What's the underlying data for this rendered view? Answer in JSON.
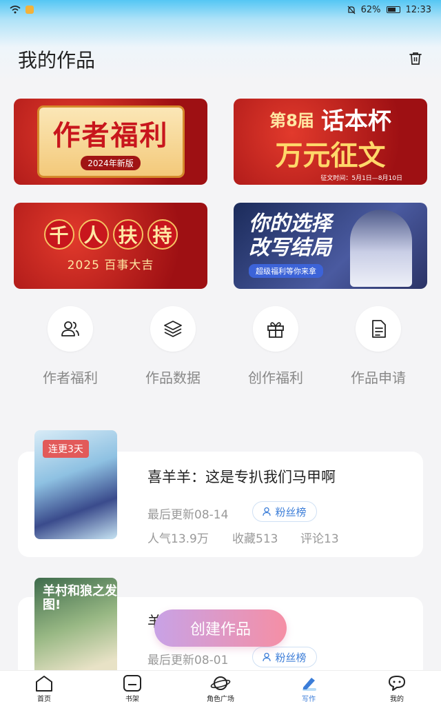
{
  "status_bar": {
    "battery": "62%",
    "time": "12:33"
  },
  "header": {
    "title": "我的作品"
  },
  "banners": [
    {
      "title": "作者福利",
      "subtitle": "2024年新版"
    },
    {
      "line1": "第8届",
      "line2": "话本杯",
      "line3": "万元征文",
      "note": "征文时间：5月1日—8月10日"
    },
    {
      "chars": [
        "千",
        "人",
        "扶",
        "持"
      ],
      "subtitle": "2025 百事大吉"
    },
    {
      "line1": "你的选择",
      "line2": "改写结局",
      "subtitle": "超级福利等你来拿"
    }
  ],
  "quick_actions": [
    {
      "label": "作者福利",
      "icon": "users-icon"
    },
    {
      "label": "作品数据",
      "icon": "layers-icon"
    },
    {
      "label": "创作福利",
      "icon": "gift-icon"
    },
    {
      "label": "作品申请",
      "icon": "document-icon"
    }
  ],
  "works": [
    {
      "badge": "连更3天",
      "title": "喜羊羊：这是专扒我们马甲啊",
      "updated": "最后更新08-14",
      "fans_label": "粉丝榜",
      "popularity": "人气13.9万",
      "favorites": "收藏513",
      "comments": "评论13"
    },
    {
      "cover_title": "羊村和狼之发图!",
      "title": "羊",
      "updated": "最后更新08-01",
      "fans_label": "粉丝榜"
    }
  ],
  "create_button": "创建作品",
  "tabs": [
    {
      "label": "首页",
      "icon": "home-icon"
    },
    {
      "label": "书架",
      "icon": "bookshelf-icon"
    },
    {
      "label": "角色广场",
      "icon": "planet-icon"
    },
    {
      "label": "写作",
      "icon": "pen-icon",
      "active": true
    },
    {
      "label": "我的",
      "icon": "chat-icon"
    }
  ],
  "colors": {
    "accent": "#3b7dd8",
    "create_gradient": [
      "#c8a2e6",
      "#f58fa5"
    ]
  }
}
